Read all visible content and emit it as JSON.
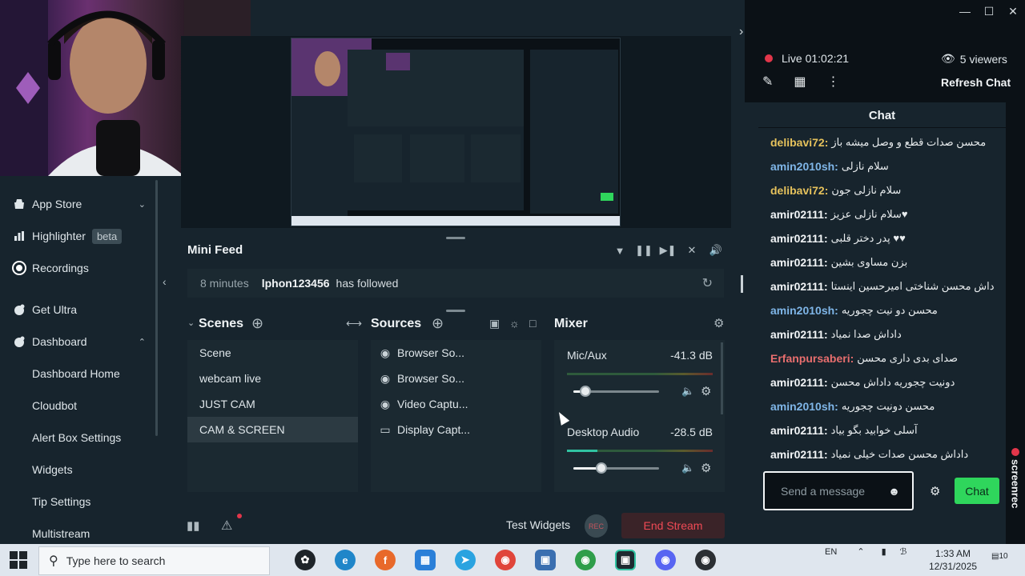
{
  "sidebar": {
    "items": [
      {
        "label": "App Store",
        "icon": "store-icon"
      },
      {
        "label": "Highlighter",
        "badge": "beta",
        "icon": "highlighter-icon"
      },
      {
        "label": "Recordings",
        "icon": "record-icon"
      },
      {
        "label": "Get Ultra",
        "icon": "ultra-icon"
      },
      {
        "label": "Dashboard",
        "icon": "dashboard-icon"
      }
    ],
    "sub_items": [
      "Dashboard Home",
      "Cloudbot",
      "Alert Box Settings",
      "Widgets",
      "Tip Settings",
      "Multistream"
    ]
  },
  "mini_feed": {
    "title": "Mini Feed",
    "event": {
      "time": "8 minutes",
      "user": "lphon123456",
      "action": "has followed"
    }
  },
  "scenes": {
    "title": "Scenes",
    "items": [
      "Scene",
      "webcam live",
      "JUST CAM",
      "CAM & SCREEN"
    ],
    "active": "CAM & SCREEN"
  },
  "sources": {
    "title": "Sources",
    "items": [
      {
        "label": "Browser So...",
        "icon": "globe-icon"
      },
      {
        "label": "Browser So...",
        "icon": "globe-icon"
      },
      {
        "label": "Video Captu...",
        "icon": "webcam-icon"
      },
      {
        "label": "Display Capt...",
        "icon": "monitor-icon"
      }
    ]
  },
  "mixer": {
    "title": "Mixer",
    "channels": [
      {
        "name": "Mic/Aux",
        "db": "-41.3 dB",
        "volume": 0.14,
        "level": 0.0
      },
      {
        "name": "Desktop Audio",
        "db": "-28.5 dB",
        "volume": 0.33,
        "level": 0.21
      }
    ]
  },
  "bottom": {
    "test_widgets": "Test Widgets",
    "rec": "REC",
    "end_stream": "End Stream"
  },
  "chat": {
    "live": "Live 01:02:21",
    "viewers": "5 viewers",
    "refresh": "Refresh Chat",
    "header": "Chat",
    "placeholder": "Send a message",
    "send": "Chat",
    "messages": [
      {
        "user": "delibavi72",
        "text": "محسن صدات قطع و وصل میشه باز",
        "color": "#e6c25c"
      },
      {
        "user": "amin2010sh",
        "text": "سلام نازلی",
        "color": "#7fb6e8"
      },
      {
        "user": "delibavi72",
        "text": "سلام نازلی جون",
        "color": "#e6c25c"
      },
      {
        "user": "amir02111",
        "text": "سلام نازلی عزیز♥",
        "color": "#f2f5f7"
      },
      {
        "user": "amir02111",
        "text": "پدر دختر قلبی ♥♥",
        "color": "#f2f5f7"
      },
      {
        "user": "amir02111",
        "text": "بزن مساوی بشین",
        "color": "#f2f5f7"
      },
      {
        "user": "amir02111",
        "text": "داش محسن شناختی امیرحسین اینستا",
        "color": "#f2f5f7"
      },
      {
        "user": "amin2010sh",
        "text": "محسن دو نیت چجوریه",
        "color": "#7fb6e8"
      },
      {
        "user": "amir02111",
        "text": "داداش صدا نمیاد",
        "color": "#f2f5f7"
      },
      {
        "user": "Erfanpursaberi",
        "text": "صدای بدی داری محسن",
        "color": "#e86e6e"
      },
      {
        "user": "amir02111",
        "text": "دونیت چجوریه داداش محسن",
        "color": "#f2f5f7"
      },
      {
        "user": "amin2010sh",
        "text": "محسن دونیت چجوریه",
        "color": "#7fb6e8"
      },
      {
        "user": "amir02111",
        "text": "آسلی خوابید بگو بیاد",
        "color": "#f2f5f7"
      },
      {
        "user": "amir02111",
        "text": "داداش محسن صدات خیلی نمیاد",
        "color": "#f2f5f7"
      }
    ]
  },
  "screenrec": "screenrec",
  "taskbar": {
    "search_placeholder": "Type here to search",
    "lang": "EN",
    "time": "1:33 AM",
    "date": "12/31/2025",
    "notifications": "10"
  }
}
